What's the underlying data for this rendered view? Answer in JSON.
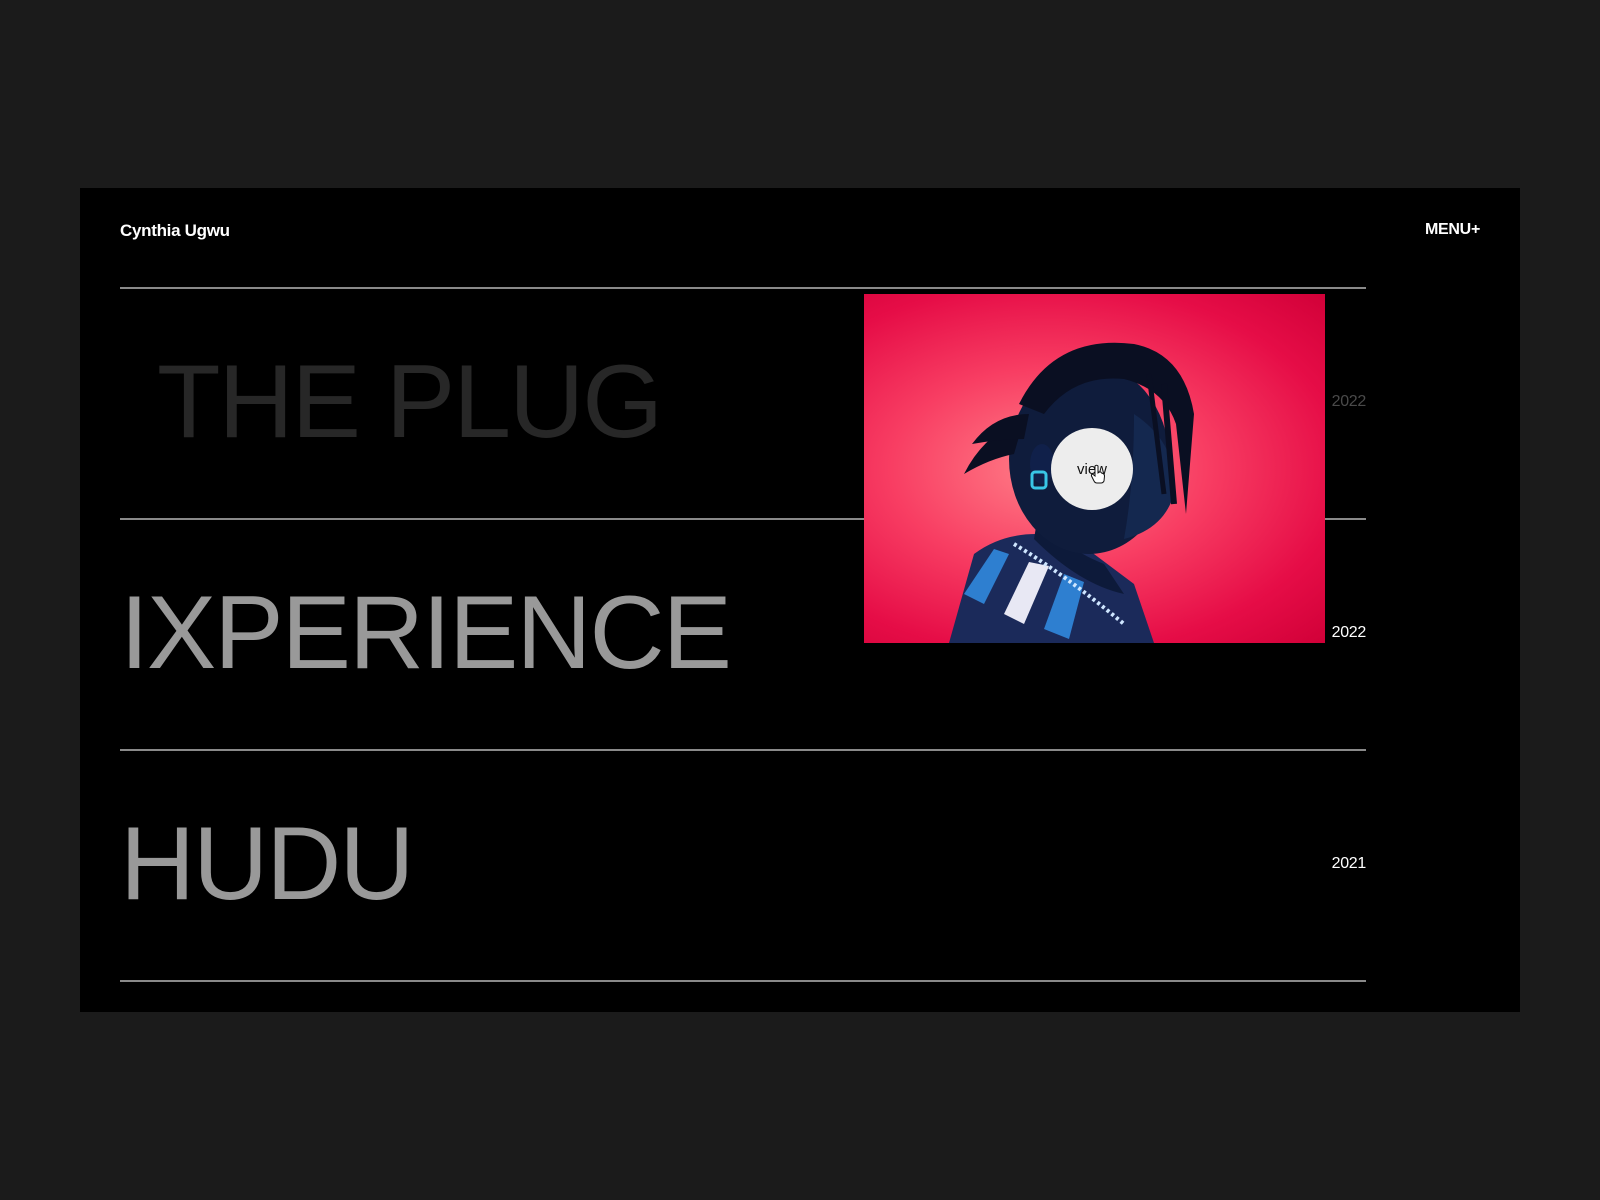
{
  "header": {
    "brand": "Cynthia Ugwu",
    "menu_label": "MENU+"
  },
  "projects": [
    {
      "title": "THE PLUG",
      "year": "2022"
    },
    {
      "title": "IXPERIENCE",
      "year": "2022"
    },
    {
      "title": "HUDU",
      "year": "2021"
    }
  ],
  "preview": {
    "view_label": "view",
    "background_color": "#f0164f",
    "image_subject": "portrait-photo"
  },
  "colors": {
    "page_background": "#1b1b1b",
    "frame_background": "#000000",
    "title_active": "#999999",
    "title_dim": "#272727",
    "divider": "#8a8a8a"
  }
}
